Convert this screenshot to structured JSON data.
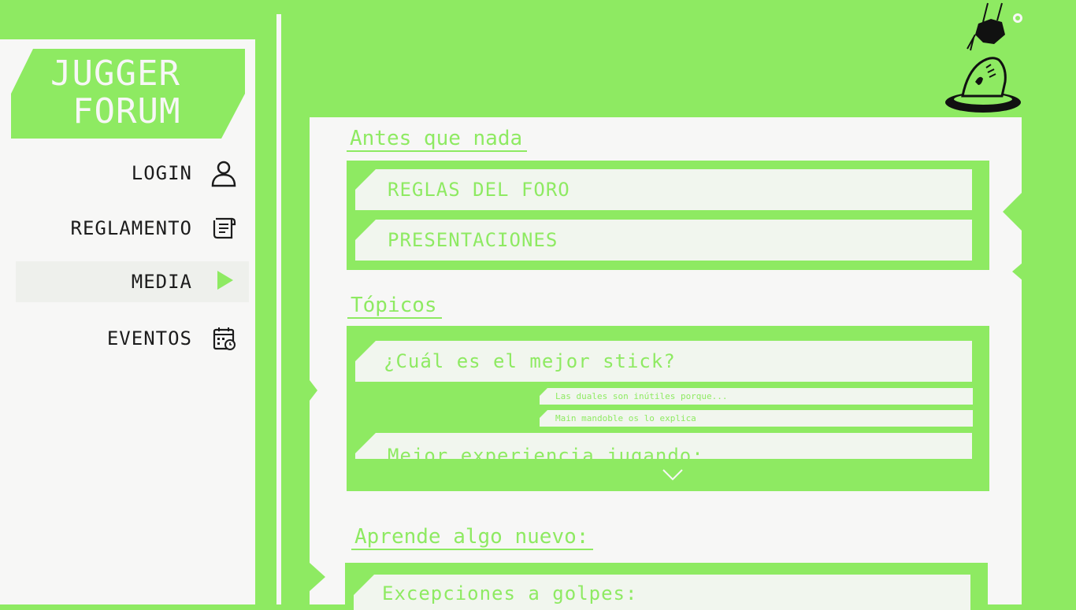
{
  "app": {
    "logo_line1": "JUGGER",
    "logo_line2": "FORUM"
  },
  "nav": {
    "items": [
      {
        "label": "LOGIN",
        "icon": "user-icon"
      },
      {
        "label": "REGLAMENTO",
        "icon": "document-icon"
      },
      {
        "label": "MEDIA",
        "icon": "play-icon",
        "active": true
      },
      {
        "label": "EVENTOS",
        "icon": "calendar-icon"
      }
    ]
  },
  "sections": {
    "antes": {
      "title": "Antes que nada",
      "items": [
        "REGLAS DEL FORO",
        "PRESENTACIONES"
      ]
    },
    "topicos": {
      "title": "Tópicos",
      "items": [
        {
          "title": "¿Cuál es el mejor stick?",
          "replies": [
            "Las duales son inútiles porque...",
            "Main mandoble os lo explica"
          ]
        },
        {
          "title": "Mejor experiencia jugando:"
        }
      ]
    },
    "aprende": {
      "title": "Aprende algo nuevo:",
      "items": [
        "Excepciones a golpes:"
      ]
    }
  },
  "colors": {
    "accent": "#8eea62",
    "surface": "#f7f7f6",
    "card": "#f1f6ee",
    "text_dark": "#1c1c1c"
  }
}
